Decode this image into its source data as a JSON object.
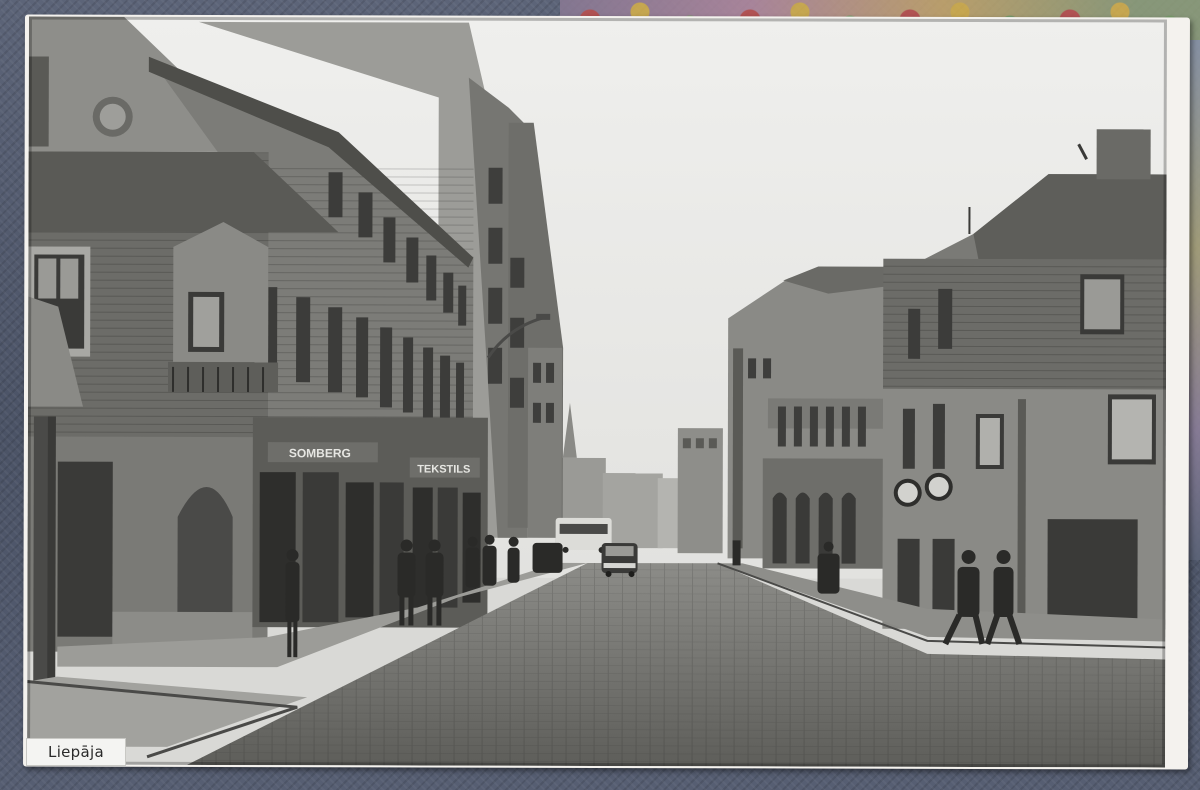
{
  "photo": {
    "caption": "Liepāja",
    "alt": "",
    "shop_signs": [
      "SOMBERG",
      "TEKSTILS"
    ]
  },
  "colors": {
    "sky": "#ececea",
    "building_dark": "#4a4a48",
    "building_mid": "#7a7a76",
    "street": "#6e6e6a",
    "card_border": "#f4f2ee"
  }
}
